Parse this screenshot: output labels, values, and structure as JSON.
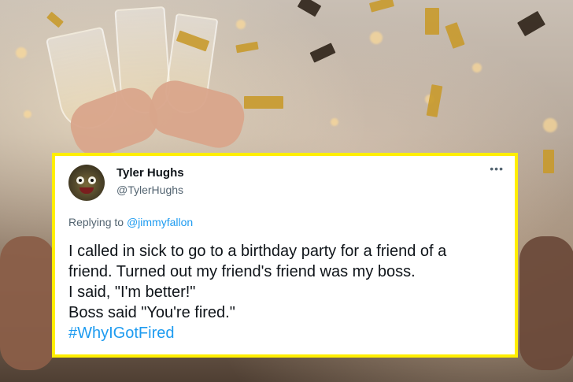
{
  "tweet": {
    "display_name": "Tyler Hughs",
    "handle": "@TylerHughs",
    "more_icon": "•••",
    "replying_prefix": "Replying to ",
    "replying_to": "@jimmyfallon",
    "lines": [
      "I called in sick to go to a birthday party for a friend of a",
      "friend. Turned out my friend's friend was my boss.",
      "I said, \"I'm better!\"",
      "Boss said \"You're fired.\""
    ],
    "hashtag": "#WhyIGotFired"
  },
  "colors": {
    "card_border": "#ffee00",
    "link": "#1d9bf0",
    "text": "#0f1419",
    "muted": "#536471"
  },
  "icons": {
    "avatar": "puppet-avatar-icon",
    "more": "more-options-icon"
  }
}
